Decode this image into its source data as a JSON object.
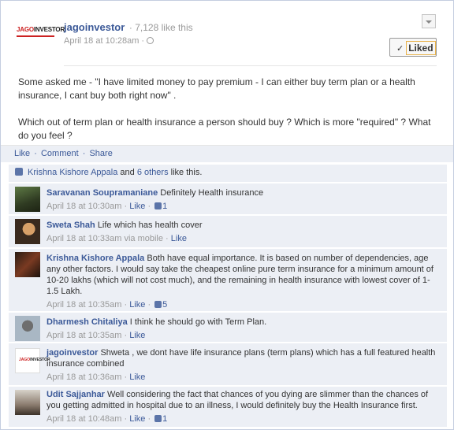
{
  "post": {
    "page_name": "jagoinvestor",
    "page_likes": "· 7,128 like this",
    "date": "April 18 at 10:28am",
    "liked_label": "Liked",
    "paragraph1": "Some asked me - \"I have limited money to pay premium - I can either buy term plan or a health insurance, I cant buy both right now\" .",
    "paragraph2": "Which out of term plan or health insurance a person should buy ? Which is more \"required\" ? What do you feel ?"
  },
  "logo": {
    "brand_prefix": "JAGO",
    "brand_suffix": "INVESTOR"
  },
  "actions": {
    "like": "Like",
    "comment": "Comment",
    "share": "Share",
    "separator": "·"
  },
  "likes_summary": {
    "first_name": "Krishna Kishore Appala",
    "connector": "and",
    "others": "6 others",
    "suffix": "like this."
  },
  "comments": [
    {
      "author": "Saravanan Soupramaniane",
      "text": "Definitely Health insurance",
      "time": "April 18 at 10:30am",
      "like": "Like",
      "likes": "1"
    },
    {
      "author": "Sweta Shah",
      "text": "Life which has health cover",
      "time": "April 18 at 10:33am via mobile",
      "like": "Like",
      "likes": ""
    },
    {
      "author": "Krishna Kishore Appala",
      "text": "Both have equal importance. It is based on number of dependencies, age any other factors. I would say take the cheapest online pure term insurance for a minimum amount of 10-20 lakhs (which will not cost much), and the remaining in health insurance with lowest cover of 1-1.5 Lakh.",
      "time": "April 18 at 10:35am",
      "like": "Like",
      "likes": "5"
    },
    {
      "author": "Dharmesh Chitaliya",
      "text": "I think he should go with Term Plan.",
      "time": "April 18 at 10:35am",
      "like": "Like",
      "likes": ""
    },
    {
      "author": "jagoinvestor",
      "text": "Shweta , we dont have life insurance plans (term plans) which has a full featured health insurance combined",
      "time": "April 18 at 10:36am",
      "like": "Like",
      "likes": ""
    },
    {
      "author": "Udit Sajjanhar",
      "text": "Well considering the fact that chances of you dying are slimmer than the chances of you getting admitted in hospital due to an illness, I would definitely buy the Health Insurance first.",
      "time": "April 18 at 10:48am",
      "like": "Like",
      "likes": "1"
    }
  ]
}
